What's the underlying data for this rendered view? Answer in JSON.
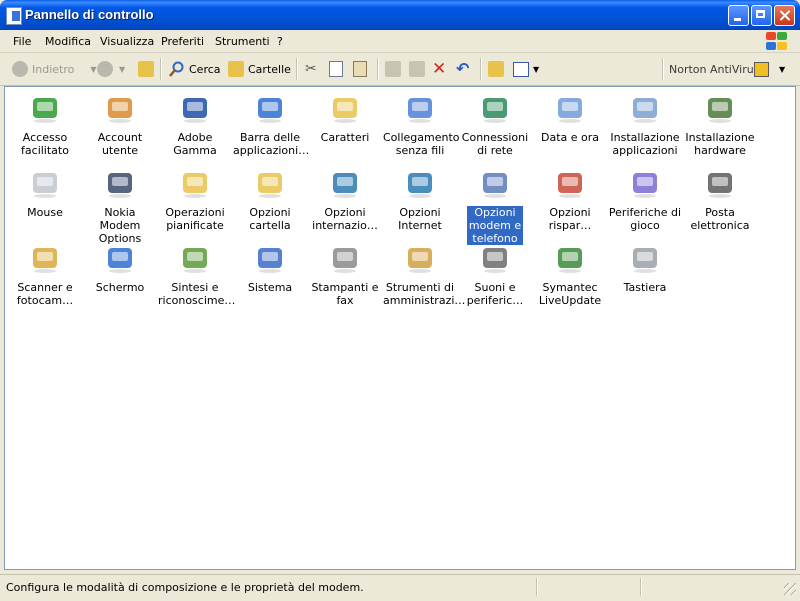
{
  "window": {
    "title": "Pannello di controllo"
  },
  "menu": [
    "File",
    "Modifica",
    "Visualizza",
    "Preferiti",
    "Strumenti",
    "?"
  ],
  "toolbar": {
    "back_label": "Indietro",
    "search_label": "Cerca",
    "folders_label": "Cartelle",
    "norton_label": "Norton AntiVirus"
  },
  "items": [
    {
      "label": "Accesso facilitato",
      "icon": "accessibility-icon",
      "color": "#2a9a2a"
    },
    {
      "label": "Account utente",
      "icon": "users-icon",
      "color": "#d98a2b"
    },
    {
      "label": "Adobe Gamma",
      "icon": "monitor-icon",
      "color": "#1d4fa8"
    },
    {
      "label": "Barra delle applicazioni…",
      "icon": "taskbar-icon",
      "color": "#2e6fd1"
    },
    {
      "label": "Caratteri",
      "icon": "fonts-folder-icon",
      "color": "#e8c24a"
    },
    {
      "label": "Collegamento senza fili",
      "icon": "wireless-laptop-icon",
      "color": "#4d7fd6"
    },
    {
      "label": "Connessioni di rete",
      "icon": "network-globe-icon",
      "color": "#2a8a5a"
    },
    {
      "label": "Data e ora",
      "icon": "clock-icon",
      "color": "#6e9bd8"
    },
    {
      "label": "Installazione applicazioni",
      "icon": "install-cd-icon",
      "color": "#7aa0d0"
    },
    {
      "label": "Installazione hardware",
      "icon": "hardware-icon",
      "color": "#4a7a3a"
    },
    {
      "label": "Mouse",
      "icon": "mouse-icon",
      "color": "#bfc4cc"
    },
    {
      "label": "Nokia Modem Options",
      "icon": "nokia-phone-icon",
      "color": "#3a4a6a"
    },
    {
      "label": "Operazioni pianificate",
      "icon": "scheduled-folder-icon",
      "color": "#e8c24a"
    },
    {
      "label": "Opzioni cartella",
      "icon": "folder-options-icon",
      "color": "#e8c24a"
    },
    {
      "label": "Opzioni internazio…",
      "icon": "globe-icon",
      "color": "#2a7ab0"
    },
    {
      "label": "Opzioni Internet",
      "icon": "internet-globe-icon",
      "color": "#2a7ab0"
    },
    {
      "label": "Opzioni modem e telefono",
      "icon": "modem-phone-icon",
      "color": "#5a7ab8"
    },
    {
      "label": "Opzioni rispar…",
      "icon": "power-plug-icon",
      "color": "#c74a3a"
    },
    {
      "label": "Periferiche di gioco",
      "icon": "gamepad-icon",
      "color": "#7a6ad0"
    },
    {
      "label": "Posta elettronica",
      "icon": "mail-icon",
      "color": "#5a5a5a"
    },
    {
      "label": "Scanner e fotocam…",
      "icon": "scanner-camera-icon",
      "color": "#d9a83a"
    },
    {
      "label": "Schermo",
      "icon": "display-icon",
      "color": "#2e6fd1"
    },
    {
      "label": "Sintesi e riconoscime…",
      "icon": "speech-icon",
      "color": "#5a9a3a"
    },
    {
      "label": "Sistema",
      "icon": "system-icon",
      "color": "#3a6ac8"
    },
    {
      "label": "Stampanti e fax",
      "icon": "printer-icon",
      "color": "#8a8a8a"
    },
    {
      "label": "Strumenti di amministrazi…",
      "icon": "admin-tools-icon",
      "color": "#d0a040"
    },
    {
      "label": "Suoni e periferic…",
      "icon": "speaker-icon",
      "color": "#6a6a6a"
    },
    {
      "label": "Symantec LiveUpdate",
      "icon": "liveupdate-icon",
      "color": "#3a8a3a"
    },
    {
      "label": "Tastiera",
      "icon": "keyboard-icon",
      "color": "#9aa0a8"
    }
  ],
  "selected_index": 16,
  "status": {
    "text": "Configura le modalità di composizione e le proprietà del modem."
  }
}
